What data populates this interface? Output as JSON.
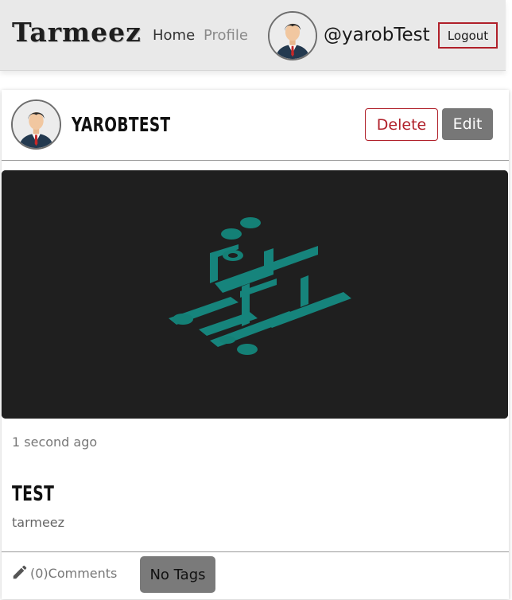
{
  "navbar": {
    "brand": "Tarmeez",
    "links": [
      {
        "label": "Home",
        "active": true
      },
      {
        "label": "Profile",
        "active": false
      }
    ],
    "username": "@yarobTest",
    "logout_label": "Logout"
  },
  "post": {
    "author": "YAROBTEST",
    "delete_label": "Delete",
    "edit_label": "Edit",
    "timestamp": "1 second ago",
    "title": "TEST",
    "body": "tarmeez",
    "comments_label": "(0)Comments",
    "tags_label": "No Tags"
  },
  "icons": {
    "avatar": "user-avatar-icon",
    "edit": "pencil-icon"
  },
  "colors": {
    "accent_red": "#b0202a",
    "logo_teal": "#16847c",
    "image_bg": "#1f1f1f",
    "edit_button": "#777777"
  }
}
